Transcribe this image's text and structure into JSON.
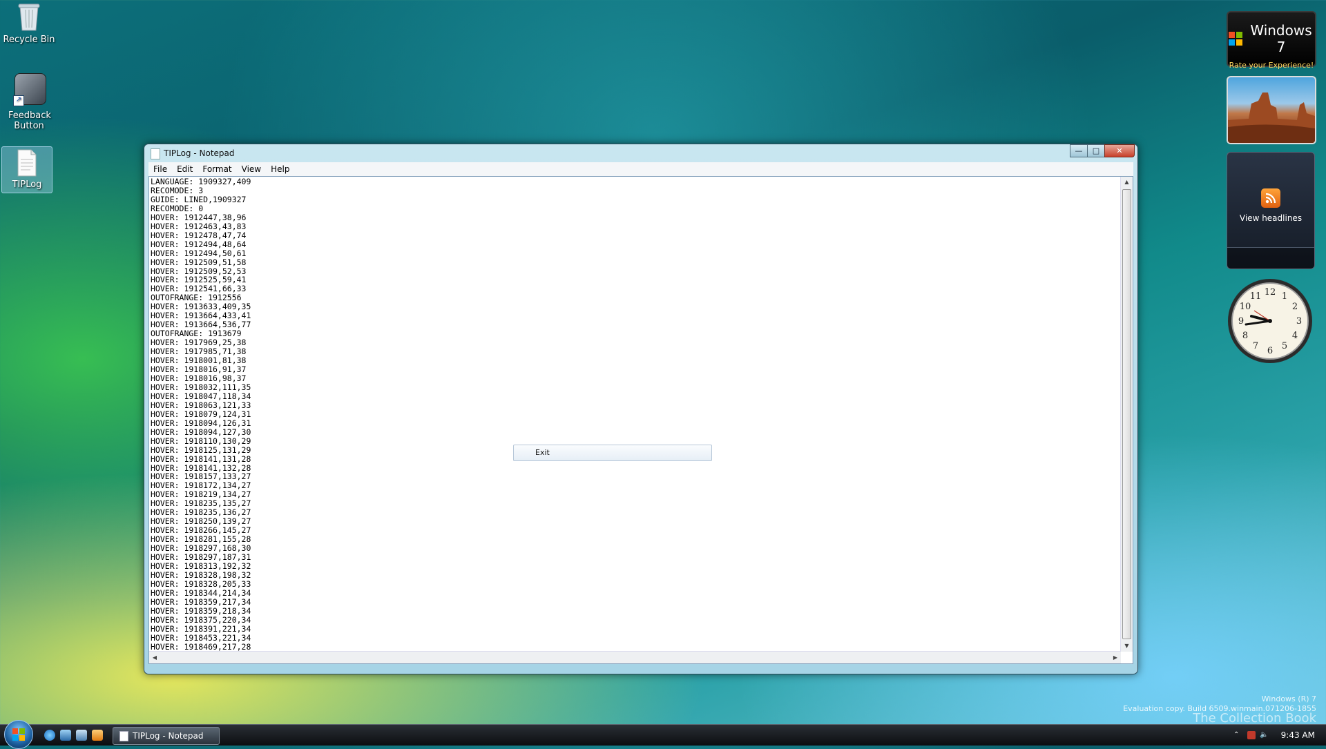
{
  "desktop": {
    "icons": [
      {
        "label": "Recycle Bin"
      },
      {
        "label": "Feedback Button"
      },
      {
        "label": "TIPLog"
      }
    ]
  },
  "gadgets": {
    "win7_title": "Windows 7",
    "win7_subtitle": "Rate your Experience!",
    "feed_label": "View headlines"
  },
  "notepad": {
    "title": "TIPLog - Notepad",
    "menu": [
      "File",
      "Edit",
      "Format",
      "View",
      "Help"
    ],
    "lines": [
      "LANGUAGE: 1909327,409",
      "RECOMODE: 3",
      "GUIDE: LINED,1909327",
      "RECOMODE: 0",
      "HOVER: 1912447,38,96",
      "HOVER: 1912463,43,83",
      "HOVER: 1912478,47,74",
      "HOVER: 1912494,48,64",
      "HOVER: 1912494,50,61",
      "HOVER: 1912509,51,58",
      "HOVER: 1912509,52,53",
      "HOVER: 1912525,59,41",
      "HOVER: 1912541,66,33",
      "OUTOFRANGE: 1912556",
      "HOVER: 1913633,409,35",
      "HOVER: 1913664,433,41",
      "HOVER: 1913664,536,77",
      "OUTOFRANGE: 1913679",
      "HOVER: 1917969,25,38",
      "HOVER: 1917985,71,38",
      "HOVER: 1918001,81,38",
      "HOVER: 1918016,91,37",
      "HOVER: 1918016,98,37",
      "HOVER: 1918032,111,35",
      "HOVER: 1918047,118,34",
      "HOVER: 1918063,121,33",
      "HOVER: 1918079,124,31",
      "HOVER: 1918094,126,31",
      "HOVER: 1918094,127,30",
      "HOVER: 1918110,130,29",
      "HOVER: 1918125,131,29",
      "HOVER: 1918141,131,28",
      "HOVER: 1918141,132,28",
      "HOVER: 1918157,133,27",
      "HOVER: 1918172,134,27",
      "HOVER: 1918219,134,27",
      "HOVER: 1918235,135,27",
      "HOVER: 1918235,136,27",
      "HOVER: 1918250,139,27",
      "HOVER: 1918266,145,27",
      "HOVER: 1918281,155,28",
      "HOVER: 1918297,168,30",
      "HOVER: 1918297,187,31",
      "HOVER: 1918313,192,32",
      "HOVER: 1918328,198,32",
      "HOVER: 1918328,205,33",
      "HOVER: 1918344,214,34",
      "HOVER: 1918359,217,34",
      "HOVER: 1918359,218,34",
      "HOVER: 1918375,220,34",
      "HOVER: 1918391,221,34",
      "HOVER: 1918453,221,34",
      "HOVER: 1918469,217,28"
    ],
    "text": ""
  },
  "context_menu": {
    "item": "Exit"
  },
  "taskbar": {
    "task_label": "TIPLog - Notepad",
    "time": "9:43 AM"
  },
  "watermark": {
    "line1": "Windows (R) 7",
    "line2": "Evaluation copy. Build 6509.winmain.071206-1855",
    "line3": "The Collection Book"
  },
  "colors": {
    "close_button": "#c8402a",
    "gadget_accent": "#ffd860"
  }
}
